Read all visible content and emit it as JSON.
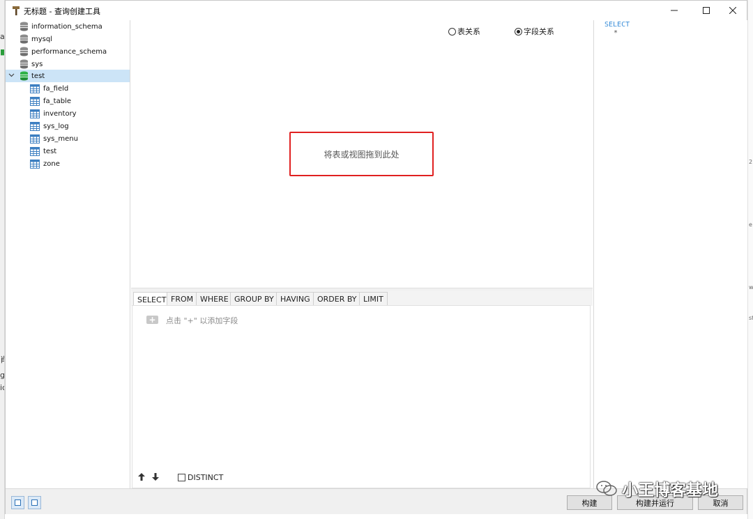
{
  "window": {
    "title": "无标题 - 查询创建工具"
  },
  "tree": {
    "databases": [
      {
        "label": "information_schema"
      },
      {
        "label": "mysql"
      },
      {
        "label": "performance_schema"
      },
      {
        "label": "sys"
      },
      {
        "label": "test",
        "expanded": true,
        "selected": true
      }
    ],
    "tables": [
      {
        "label": "fa_field"
      },
      {
        "label": "fa_table"
      },
      {
        "label": "inventory"
      },
      {
        "label": "sys_log"
      },
      {
        "label": "sys_menu"
      },
      {
        "label": "test"
      },
      {
        "label": "zone"
      }
    ]
  },
  "design": {
    "radio_table": "表关系",
    "radio_field": "字段关系",
    "selected_radio": "字段关系",
    "drop_hint": "将表或视图拖到此处"
  },
  "tabs": [
    "SELECT",
    "FROM",
    "WHERE",
    "GROUP BY",
    "HAVING",
    "ORDER BY",
    "LIMIT"
  ],
  "active_tab": "SELECT",
  "clause": {
    "add_hint": "点击 \"+\" 以添加字段",
    "up_arrow": "🡡",
    "down_arrow": "🡣",
    "distinct_label": "DISTINCT",
    "distinct_checked": false
  },
  "sql": {
    "keyword": "SELECT",
    "star": "*"
  },
  "buttons": {
    "build": "构建",
    "build_run": "构建并运行",
    "cancel": "取消"
  },
  "watermark": {
    "text": "小王博客基地"
  },
  "colors": {
    "accent": "#3a8ed8",
    "drop_border": "#e02020",
    "selected_row": "#cce4f7"
  },
  "icons": {
    "title": "hammer-icon",
    "database": "database-icon",
    "database_active": "database-active-icon",
    "table": "table-icon",
    "minimize": "minimize-icon",
    "maximize": "maximize-icon",
    "close": "close-icon",
    "expand": "chevron-down-icon"
  }
}
